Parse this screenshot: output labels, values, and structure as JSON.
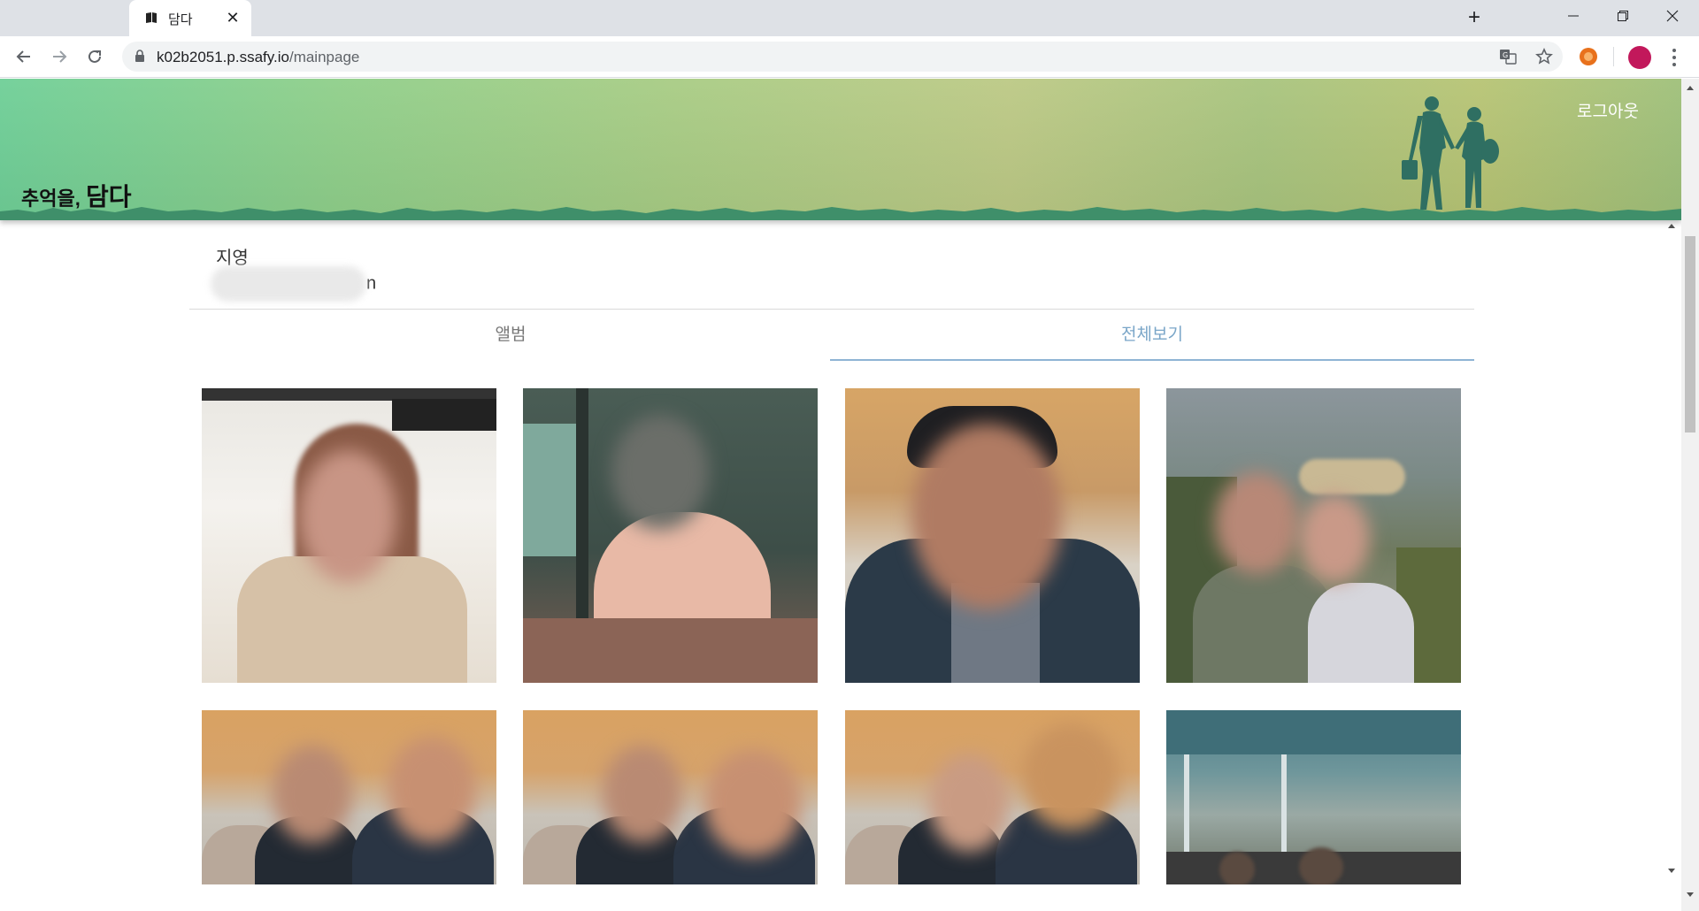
{
  "browser": {
    "tab_title": "담다",
    "url_host": "k02b2051.p.ssafy.io",
    "url_path": "/mainpage"
  },
  "header": {
    "brand_prefix": "추억을,",
    "brand_main": "담다",
    "logout_label": "로그아웃"
  },
  "profile": {
    "name": "지영",
    "email_tail": "n"
  },
  "tabs": {
    "album_label": "앨범",
    "all_label": "전체보기",
    "active": "전체보기"
  },
  "colors": {
    "accent": "#8fb4d4",
    "profile_avatar": "#c2185b"
  },
  "photos": [
    {
      "subject": "woman-chin-on-hands"
    },
    {
      "subject": "woman-floral-dress-restaurant"
    },
    {
      "subject": "man-dark-jacket-closeup"
    },
    {
      "subject": "couple-mountain-view"
    },
    {
      "subject": "couple-restaurant-1"
    },
    {
      "subject": "couple-restaurant-2"
    },
    {
      "subject": "couple-restaurant-3"
    },
    {
      "subject": "boat-tour-group"
    }
  ]
}
